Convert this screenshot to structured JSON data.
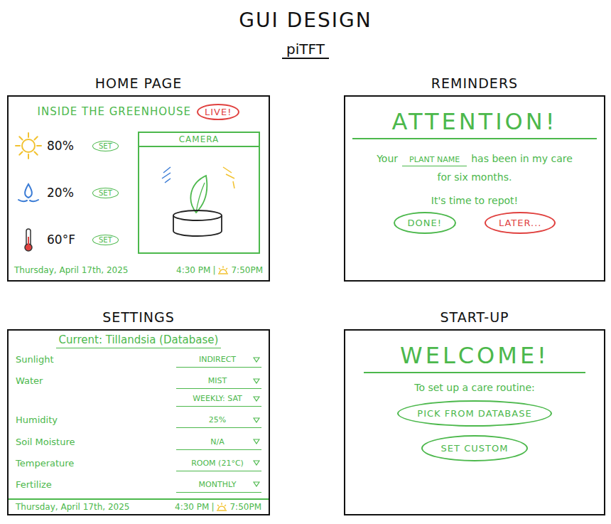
{
  "page": {
    "title": "GUI DESIGN",
    "subtitle": "piTFT"
  },
  "home": {
    "heading": "HOME PAGE",
    "title": "INSIDE THE GREENHOUSE",
    "badge": "LIVE!",
    "readings": [
      {
        "kind": "sun",
        "value": "80%",
        "button": "SET"
      },
      {
        "kind": "water",
        "value": "20%",
        "button": "SET"
      },
      {
        "kind": "thermometer",
        "value": "60°F",
        "button": "SET"
      }
    ],
    "camera": {
      "label": "CAMERA"
    },
    "footer": {
      "date": "Thursday, April 17th, 2025",
      "time": "4:30 PM",
      "separator": "|",
      "sunset": "7:50PM"
    }
  },
  "reminders": {
    "heading": "REMINDERS",
    "title": "ATTENTION!",
    "prefix": "Your",
    "plant": "PLANT NAME",
    "message": "has been in my care for six months.",
    "action": "It's time to repot!",
    "buttons": [
      {
        "label": "DONE!",
        "color": "#4cb84c"
      },
      {
        "label": "LATER...",
        "color": "#e0413f"
      }
    ]
  },
  "settings": {
    "heading": "SETTINGS",
    "current": "Current: Tillandsia (Database)",
    "rows": [
      {
        "label": "Sunlight",
        "values": [
          "INDIRECT"
        ]
      },
      {
        "label": "Water",
        "values": [
          "MIST",
          "WEEKLY: SAT"
        ]
      },
      {
        "label": "Humidity",
        "values": [
          "25%"
        ]
      },
      {
        "label": "Soil Moisture",
        "values": [
          "N/A"
        ]
      },
      {
        "label": "Temperature",
        "values": [
          "ROOM (21°C)"
        ]
      },
      {
        "label": "Fertilize",
        "values": [
          "MONTHLY"
        ]
      }
    ],
    "footer": {
      "date": "Thursday, April 17th, 2025",
      "time": "4:30 PM",
      "separator": "|",
      "sunset": "7:50PM"
    }
  },
  "startup": {
    "heading": "START-UP",
    "title": "WELCOME!",
    "prompt": "To set up a care routine:",
    "buttons": [
      "PICK FROM DATABASE",
      "SET CUSTOM"
    ]
  }
}
